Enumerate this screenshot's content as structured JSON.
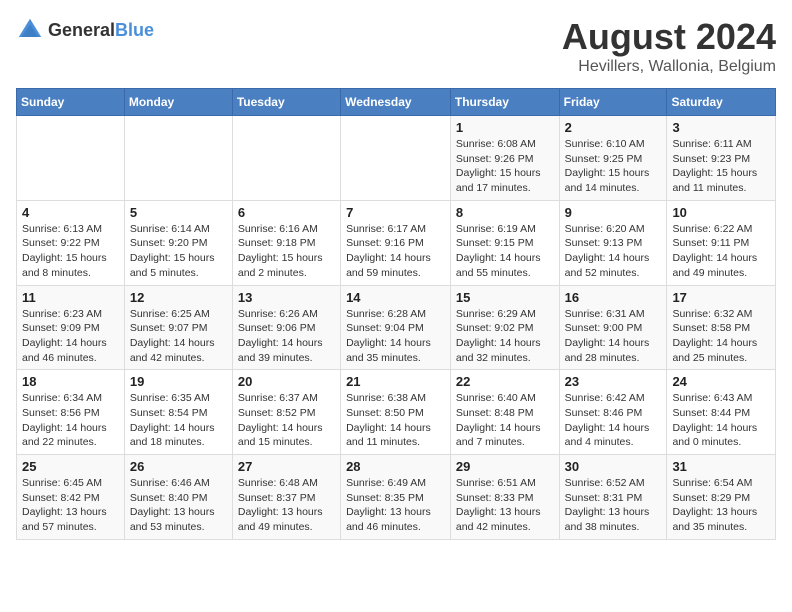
{
  "logo": {
    "text_general": "General",
    "text_blue": "Blue"
  },
  "title": "August 2024",
  "subtitle": "Hevillers, Wallonia, Belgium",
  "days_of_week": [
    "Sunday",
    "Monday",
    "Tuesday",
    "Wednesday",
    "Thursday",
    "Friday",
    "Saturday"
  ],
  "weeks": [
    [
      {
        "day": "",
        "info": ""
      },
      {
        "day": "",
        "info": ""
      },
      {
        "day": "",
        "info": ""
      },
      {
        "day": "",
        "info": ""
      },
      {
        "day": "1",
        "info": "Sunrise: 6:08 AM\nSunset: 9:26 PM\nDaylight: 15 hours and 17 minutes."
      },
      {
        "day": "2",
        "info": "Sunrise: 6:10 AM\nSunset: 9:25 PM\nDaylight: 15 hours and 14 minutes."
      },
      {
        "day": "3",
        "info": "Sunrise: 6:11 AM\nSunset: 9:23 PM\nDaylight: 15 hours and 11 minutes."
      }
    ],
    [
      {
        "day": "4",
        "info": "Sunrise: 6:13 AM\nSunset: 9:22 PM\nDaylight: 15 hours and 8 minutes."
      },
      {
        "day": "5",
        "info": "Sunrise: 6:14 AM\nSunset: 9:20 PM\nDaylight: 15 hours and 5 minutes."
      },
      {
        "day": "6",
        "info": "Sunrise: 6:16 AM\nSunset: 9:18 PM\nDaylight: 15 hours and 2 minutes."
      },
      {
        "day": "7",
        "info": "Sunrise: 6:17 AM\nSunset: 9:16 PM\nDaylight: 14 hours and 59 minutes."
      },
      {
        "day": "8",
        "info": "Sunrise: 6:19 AM\nSunset: 9:15 PM\nDaylight: 14 hours and 55 minutes."
      },
      {
        "day": "9",
        "info": "Sunrise: 6:20 AM\nSunset: 9:13 PM\nDaylight: 14 hours and 52 minutes."
      },
      {
        "day": "10",
        "info": "Sunrise: 6:22 AM\nSunset: 9:11 PM\nDaylight: 14 hours and 49 minutes."
      }
    ],
    [
      {
        "day": "11",
        "info": "Sunrise: 6:23 AM\nSunset: 9:09 PM\nDaylight: 14 hours and 46 minutes."
      },
      {
        "day": "12",
        "info": "Sunrise: 6:25 AM\nSunset: 9:07 PM\nDaylight: 14 hours and 42 minutes."
      },
      {
        "day": "13",
        "info": "Sunrise: 6:26 AM\nSunset: 9:06 PM\nDaylight: 14 hours and 39 minutes."
      },
      {
        "day": "14",
        "info": "Sunrise: 6:28 AM\nSunset: 9:04 PM\nDaylight: 14 hours and 35 minutes."
      },
      {
        "day": "15",
        "info": "Sunrise: 6:29 AM\nSunset: 9:02 PM\nDaylight: 14 hours and 32 minutes."
      },
      {
        "day": "16",
        "info": "Sunrise: 6:31 AM\nSunset: 9:00 PM\nDaylight: 14 hours and 28 minutes."
      },
      {
        "day": "17",
        "info": "Sunrise: 6:32 AM\nSunset: 8:58 PM\nDaylight: 14 hours and 25 minutes."
      }
    ],
    [
      {
        "day": "18",
        "info": "Sunrise: 6:34 AM\nSunset: 8:56 PM\nDaylight: 14 hours and 22 minutes."
      },
      {
        "day": "19",
        "info": "Sunrise: 6:35 AM\nSunset: 8:54 PM\nDaylight: 14 hours and 18 minutes."
      },
      {
        "day": "20",
        "info": "Sunrise: 6:37 AM\nSunset: 8:52 PM\nDaylight: 14 hours and 15 minutes."
      },
      {
        "day": "21",
        "info": "Sunrise: 6:38 AM\nSunset: 8:50 PM\nDaylight: 14 hours and 11 minutes."
      },
      {
        "day": "22",
        "info": "Sunrise: 6:40 AM\nSunset: 8:48 PM\nDaylight: 14 hours and 7 minutes."
      },
      {
        "day": "23",
        "info": "Sunrise: 6:42 AM\nSunset: 8:46 PM\nDaylight: 14 hours and 4 minutes."
      },
      {
        "day": "24",
        "info": "Sunrise: 6:43 AM\nSunset: 8:44 PM\nDaylight: 14 hours and 0 minutes."
      }
    ],
    [
      {
        "day": "25",
        "info": "Sunrise: 6:45 AM\nSunset: 8:42 PM\nDaylight: 13 hours and 57 minutes."
      },
      {
        "day": "26",
        "info": "Sunrise: 6:46 AM\nSunset: 8:40 PM\nDaylight: 13 hours and 53 minutes."
      },
      {
        "day": "27",
        "info": "Sunrise: 6:48 AM\nSunset: 8:37 PM\nDaylight: 13 hours and 49 minutes."
      },
      {
        "day": "28",
        "info": "Sunrise: 6:49 AM\nSunset: 8:35 PM\nDaylight: 13 hours and 46 minutes."
      },
      {
        "day": "29",
        "info": "Sunrise: 6:51 AM\nSunset: 8:33 PM\nDaylight: 13 hours and 42 minutes."
      },
      {
        "day": "30",
        "info": "Sunrise: 6:52 AM\nSunset: 8:31 PM\nDaylight: 13 hours and 38 minutes."
      },
      {
        "day": "31",
        "info": "Sunrise: 6:54 AM\nSunset: 8:29 PM\nDaylight: 13 hours and 35 minutes."
      }
    ]
  ]
}
